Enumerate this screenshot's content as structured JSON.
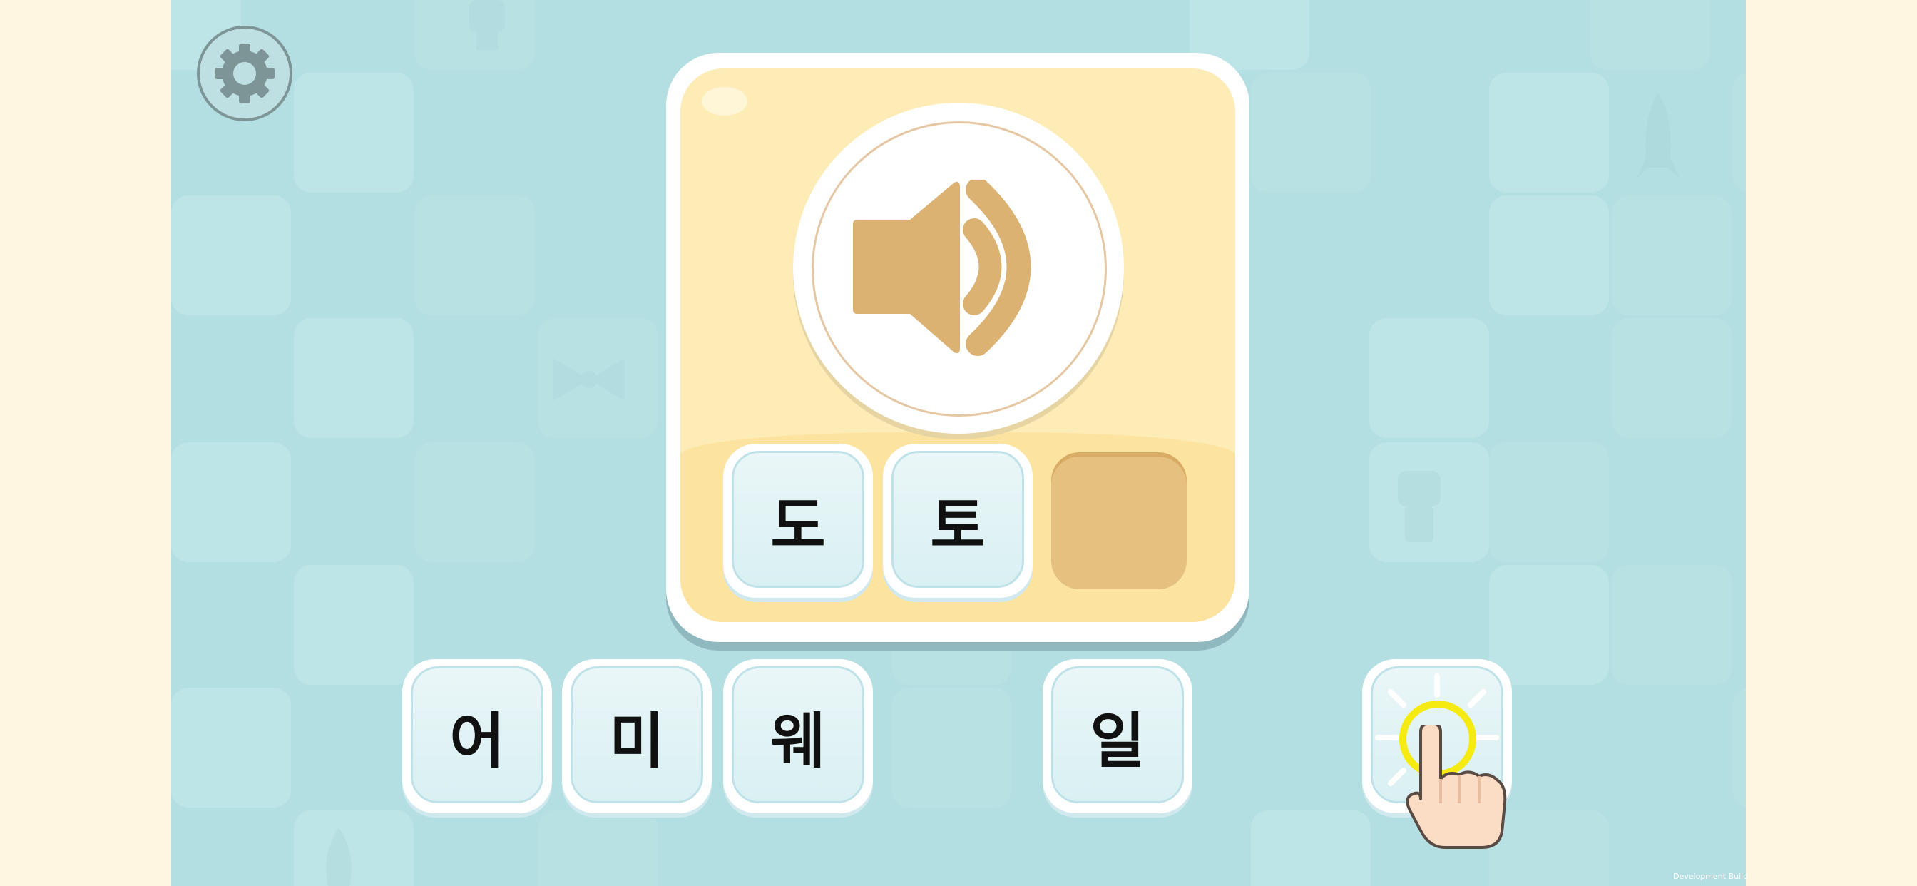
{
  "settings": {
    "icon": "gear-icon"
  },
  "prompt": {
    "icon": "speaker-icon"
  },
  "answer_slots": [
    {
      "letter": "도"
    },
    {
      "letter": "토"
    },
    {
      "letter": ""
    }
  ],
  "choices": [
    {
      "letter": "어"
    },
    {
      "letter": "미"
    },
    {
      "letter": "웨"
    },
    {
      "letter": "일"
    }
  ],
  "hint": {
    "icon": "pointing-hand-icon"
  },
  "footer": {
    "build_label": "Development Build"
  },
  "colors": {
    "background": "#b3dfe2",
    "side_panel": "#fef6e1",
    "card": "#feecb7",
    "accent": "#dbb272",
    "empty_slot": "#e6c07f",
    "highlight": "#f5ea12"
  }
}
